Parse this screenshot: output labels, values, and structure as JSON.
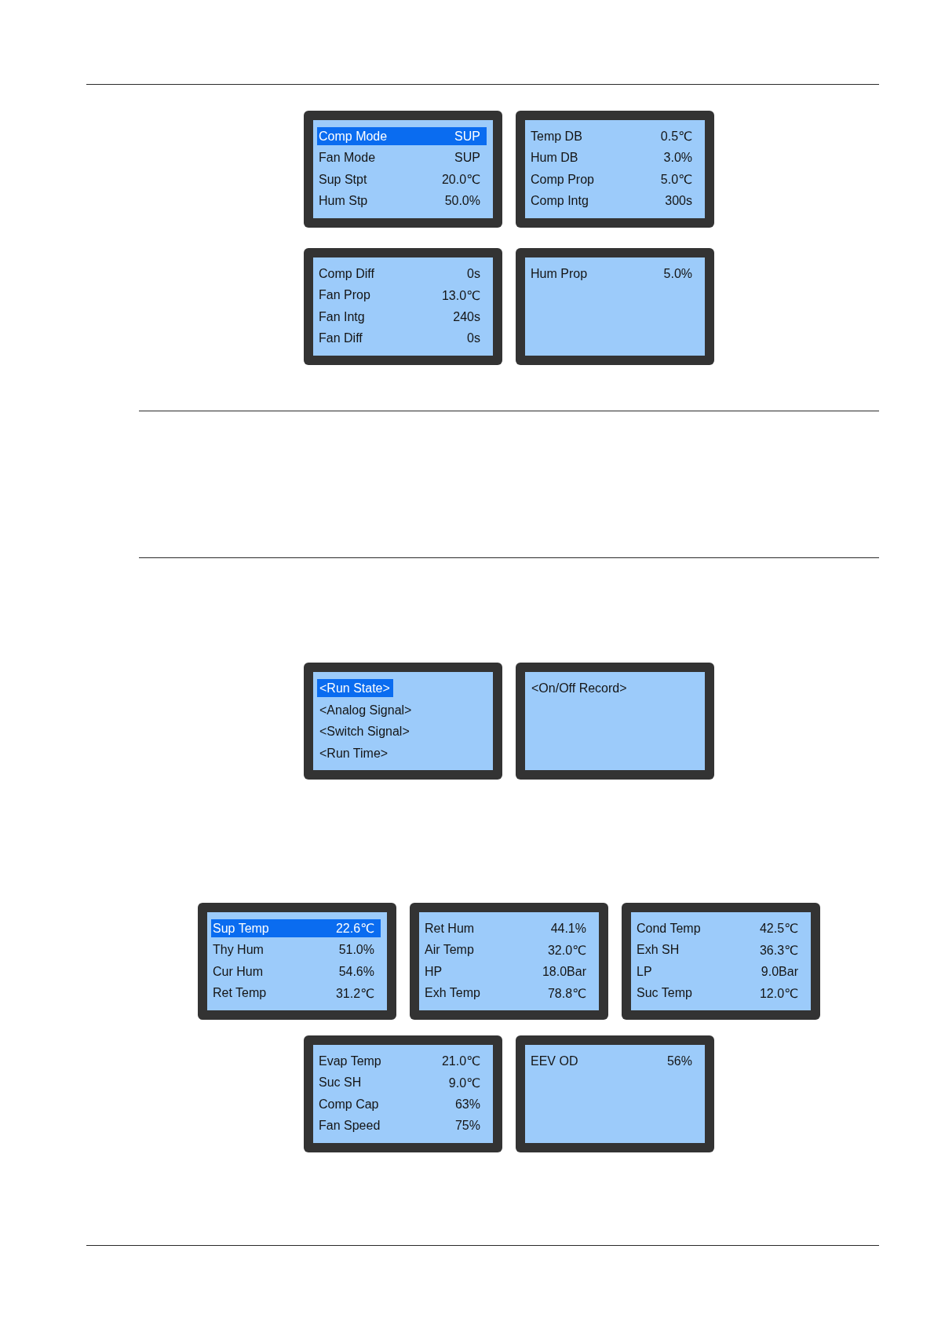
{
  "screen_rows": [
    {
      "screens": [
        {
          "kind": "parameters",
          "rows": [
            {
              "label": "Comp Mode",
              "value": "SUP",
              "selected": true
            },
            {
              "label": "Fan Mode",
              "value": "SUP",
              "selected": false
            },
            {
              "label": "Sup Stpt",
              "value": "20.0℃",
              "selected": false
            },
            {
              "label": "Hum Stp",
              "value": "50.0%",
              "selected": false
            }
          ]
        },
        {
          "kind": "parameters",
          "rows": [
            {
              "label": "Temp DB",
              "value": "0.5℃",
              "selected": false
            },
            {
              "label": "Hum DB",
              "value": "3.0%",
              "selected": false
            },
            {
              "label": "Comp Prop",
              "value": "5.0℃",
              "selected": false
            },
            {
              "label": "Comp Intg",
              "value": "300s",
              "selected": false
            }
          ]
        }
      ]
    },
    {
      "screens": [
        {
          "kind": "parameters",
          "rows": [
            {
              "label": "Comp Diff",
              "value": "0s",
              "selected": false
            },
            {
              "label": "Fan Prop",
              "value": "13.0℃",
              "selected": false
            },
            {
              "label": "Fan Intg",
              "value": "240s",
              "selected": false
            },
            {
              "label": "Fan Diff",
              "value": "0s",
              "selected": false
            }
          ]
        },
        {
          "kind": "parameters",
          "rows": [
            {
              "label": "Hum Prop",
              "value": "5.0%",
              "selected": false
            }
          ]
        }
      ]
    },
    {
      "screens": [
        {
          "kind": "menu",
          "rows": [
            {
              "label": "<Run State>",
              "selected": true
            },
            {
              "label": "<Analog Signal>",
              "selected": false
            },
            {
              "label": "<Switch Signal>",
              "selected": false
            },
            {
              "label": "<Run Time>",
              "selected": false
            }
          ]
        },
        {
          "kind": "menu",
          "rows": [
            {
              "label": "<On/Off Record>",
              "selected": false
            }
          ]
        }
      ]
    },
    {
      "screens": [
        {
          "kind": "parameters",
          "rows": [
            {
              "label": "Sup Temp",
              "value": "22.6℃",
              "selected": true
            },
            {
              "label": "Thy Hum",
              "value": "51.0%",
              "selected": false
            },
            {
              "label": "Cur Hum",
              "value": "54.6%",
              "selected": false
            },
            {
              "label": "Ret Temp",
              "value": "31.2℃",
              "selected": false
            }
          ]
        },
        {
          "kind": "parameters",
          "rows": [
            {
              "label": "Ret Hum",
              "value": "44.1%",
              "selected": false
            },
            {
              "label": "Air Temp",
              "value": "32.0℃",
              "selected": false
            },
            {
              "label": "HP",
              "value": "18.0Bar",
              "selected": false
            },
            {
              "label": "Exh Temp",
              "value": "78.8℃",
              "selected": false
            }
          ]
        },
        {
          "kind": "parameters",
          "rows": [
            {
              "label": "Cond Temp",
              "value": "42.5℃",
              "selected": false
            },
            {
              "label": "Exh SH",
              "value": "36.3℃",
              "selected": false
            },
            {
              "label": "LP",
              "value": "9.0Bar",
              "selected": false
            },
            {
              "label": "Suc Temp",
              "value": "12.0℃",
              "selected": false
            }
          ]
        }
      ]
    },
    {
      "screens": [
        {
          "kind": "parameters",
          "rows": [
            {
              "label": "Evap Temp",
              "value": "21.0℃",
              "selected": false
            },
            {
              "label": "Suc SH",
              "value": "9.0℃",
              "selected": false
            },
            {
              "label": "Comp Cap",
              "value": "63%",
              "selected": false
            },
            {
              "label": "Fan Speed",
              "value": "75%",
              "selected": false
            }
          ]
        },
        {
          "kind": "parameters",
          "rows": [
            {
              "label": "EEV OD",
              "value": "56%",
              "selected": false
            }
          ]
        }
      ]
    }
  ]
}
